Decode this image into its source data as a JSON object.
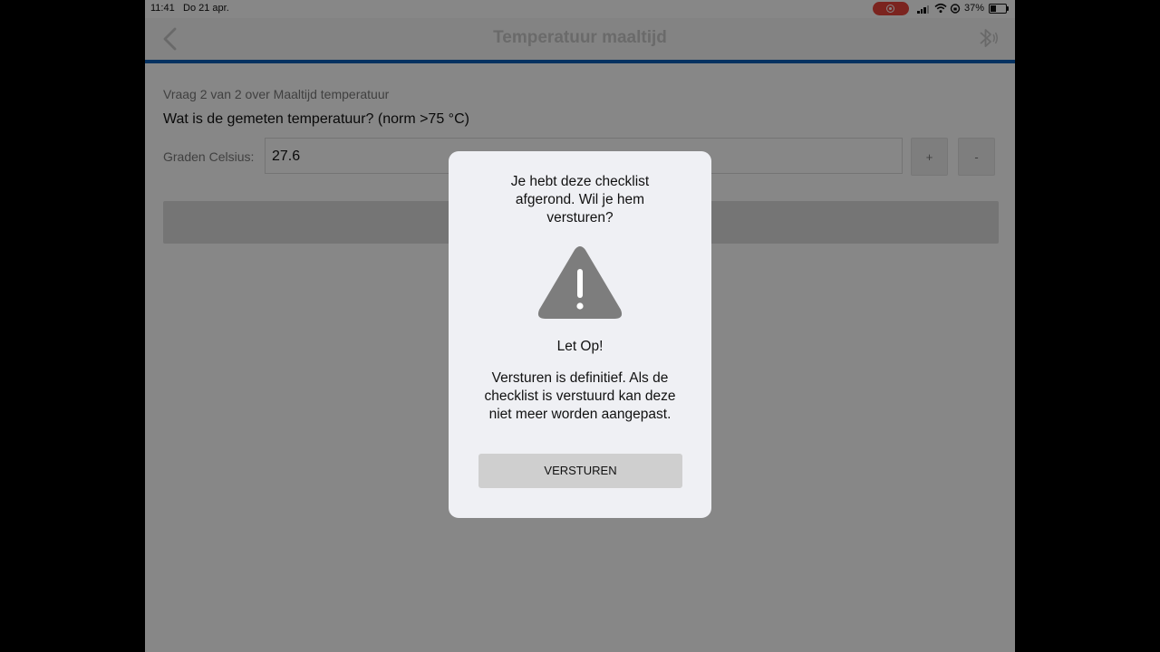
{
  "status_bar": {
    "time": "11:41",
    "date": "Do 21 apr.",
    "battery_percent": "37%",
    "battery_level": 0.37,
    "recording_color": "#e8453c"
  },
  "nav": {
    "title": "Temperatuur maaltijd",
    "back_icon": "chevron-left-icon",
    "bluetooth_icon": "bluetooth-icon",
    "accent_color": "#0a5fb8"
  },
  "question": {
    "meta": "Vraag 2 van 2 over Maaltijd temperatuur",
    "text": "Wat is de gemeten temperatuur? (norm >75 °C)",
    "field_label": "Graden Celsius:",
    "value": "27.6",
    "increment_label": "+",
    "decrement_label": "-"
  },
  "dialog": {
    "heading": "Je hebt deze checklist afgerond. Wil je hem versturen?",
    "icon": "warning-icon",
    "alert_title": "Let Op!",
    "message": "Versturen is definitief. Als de checklist is verstuurd kan deze niet meer worden aangepast.",
    "button_label": "VERSTUREN"
  }
}
